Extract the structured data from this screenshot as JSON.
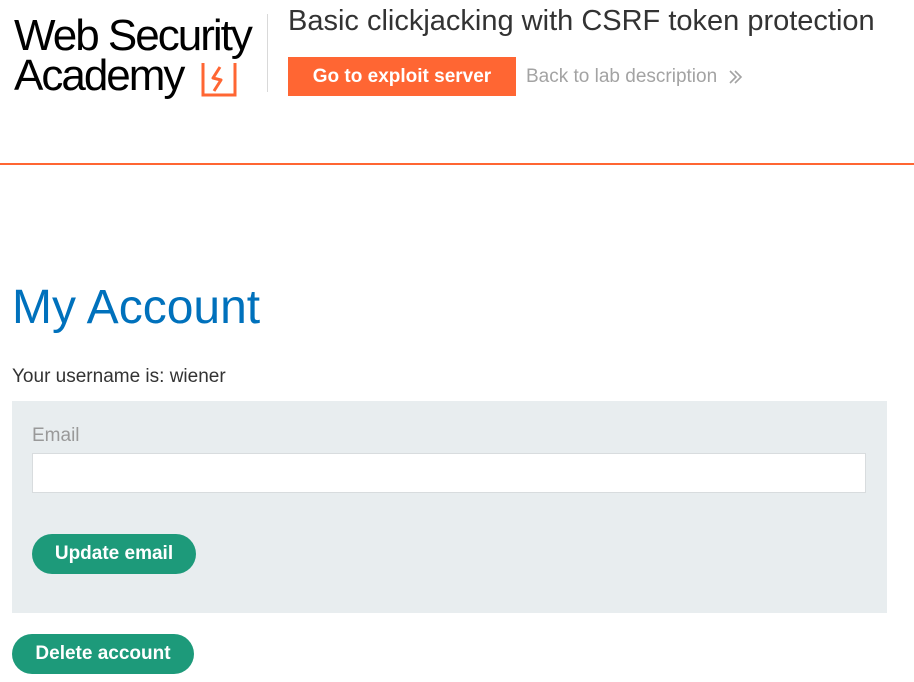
{
  "header": {
    "logo_line1": "Web Security",
    "logo_line2": "Academy",
    "lab_title": "Basic clickjacking with CSRF token protection",
    "exploit_button": "Go to exploit server",
    "back_link": "Back to lab description",
    "icons": {
      "logo_mark": "bolt-icon",
      "back_chevron": "double-chevron-right-icon"
    }
  },
  "main": {
    "title": "My Account",
    "username_line": "Your username is: wiener",
    "form": {
      "email_label": "Email",
      "email_value": "",
      "email_placeholder": "",
      "update_button": "Update email"
    },
    "delete_button": "Delete account"
  },
  "colors": {
    "accent_orange": "#ff6633",
    "title_blue": "#0071bc",
    "button_green": "#1d9a7a",
    "panel_gray": "#e8edef"
  }
}
